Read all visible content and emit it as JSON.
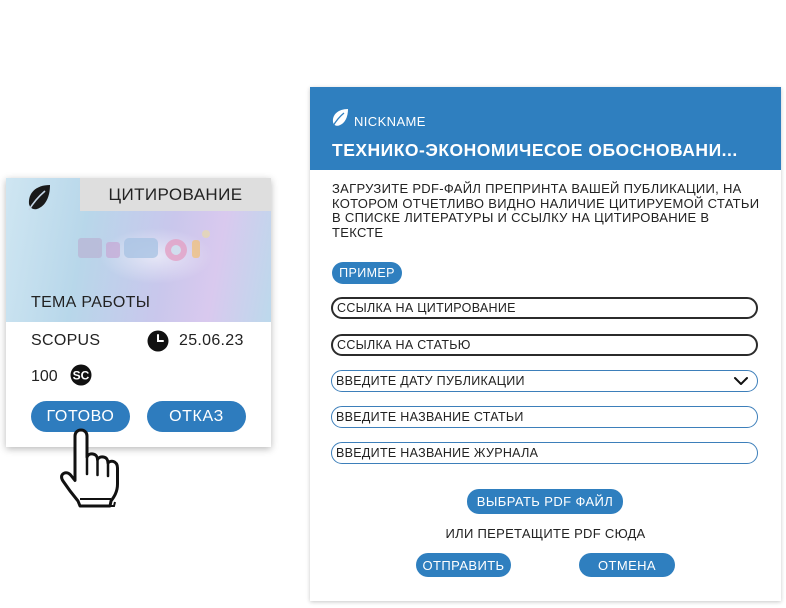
{
  "card": {
    "title": "ЦИТИРОВАНИЕ",
    "theme": "ТЕМА РАБОТЫ",
    "source": "SCOPUS",
    "date": "25.06.23",
    "points": "100",
    "sc_badge": "SC",
    "ready_label": "ГОТОВО",
    "refuse_label": "ОТКАЗ",
    "icons": {
      "logo": "leaf-icon",
      "clock": "clock-icon",
      "badge": "sc-badge-icon"
    }
  },
  "panel": {
    "nickname": "NICKNAME",
    "title": "ТЕХНИКО-ЭКОНОМИЧЕСОЕ ОБОСНОВАНИ...",
    "instructions": "ЗАГРУЗИТЕ PDF-ФАЙЛ ПРЕПРИНТА ВАШЕЙ ПУБЛИКАЦИИ, НА КОТОРОМ ОТЧЕТЛИВО ВИДНО НАЛИЧИЕ ЦИТИРУЕМОЙ СТАТЬИ В СПИСКЕ ЛИТЕРАТУРЫ И ССЫЛКУ НА ЦИТИРОВАНИЕ В ТЕКСТЕ",
    "example_label": "ПРИМЕР",
    "fields": {
      "citation_link": "ССЫЛКА НА ЦИТИРОВАНИЕ",
      "article_link": "ССЫЛКА НА СТАТЬЮ",
      "pub_date": "ВВЕДИТЕ ДАТУ ПУБЛИКАЦИИ",
      "article_name": "ВВЕДИТЕ НАЗВАНИЕ СТАТЬИ",
      "journal_name": "ВВЕДИТЕ НАЗВАНИЕ ЖУРНАЛА"
    },
    "pick_pdf_label": "ВЫБРАТЬ PDF ФАЙЛ",
    "drop_text": "ИЛИ ПЕРЕТАЩИТЕ PDF СЮДА",
    "send_label": "ОТПРАВИТЬ",
    "cancel_label": "ОТМЕНА",
    "icons": {
      "logo": "leaf-icon",
      "dropdown": "chevron-down-icon"
    }
  },
  "cursor": {
    "icon": "hand-pointer-icon"
  },
  "colors": {
    "accent": "#2f7fbf",
    "card_tab": "#dedede",
    "field_border": "#2b2b2b",
    "field_border_blue": "#3d7fba"
  }
}
